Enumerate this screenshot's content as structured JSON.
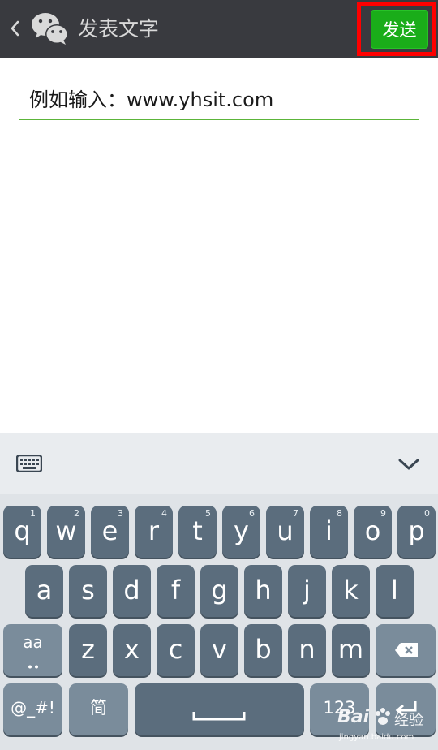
{
  "header": {
    "title": "发表文字",
    "send_label": "发送"
  },
  "input": {
    "value": "例如输入：www.yhsit.com"
  },
  "keyboard": {
    "row1": [
      {
        "key": "q",
        "num": "1"
      },
      {
        "key": "w",
        "num": "2"
      },
      {
        "key": "e",
        "num": "3"
      },
      {
        "key": "r",
        "num": "4"
      },
      {
        "key": "t",
        "num": "5"
      },
      {
        "key": "y",
        "num": "6"
      },
      {
        "key": "u",
        "num": "7"
      },
      {
        "key": "i",
        "num": "8"
      },
      {
        "key": "o",
        "num": "9"
      },
      {
        "key": "p",
        "num": "0"
      }
    ],
    "row2": [
      "a",
      "s",
      "d",
      "f",
      "g",
      "h",
      "j",
      "k",
      "l"
    ],
    "row3": [
      "z",
      "x",
      "c",
      "v",
      "b",
      "n",
      "m"
    ],
    "shift_label": "aa",
    "symbols_label": "@_#!",
    "lang_label": "简",
    "numbers_label": "123"
  },
  "watermark": {
    "brand": "Bai",
    "brand2": "经验",
    "url": "jingyan.baidu.com"
  }
}
